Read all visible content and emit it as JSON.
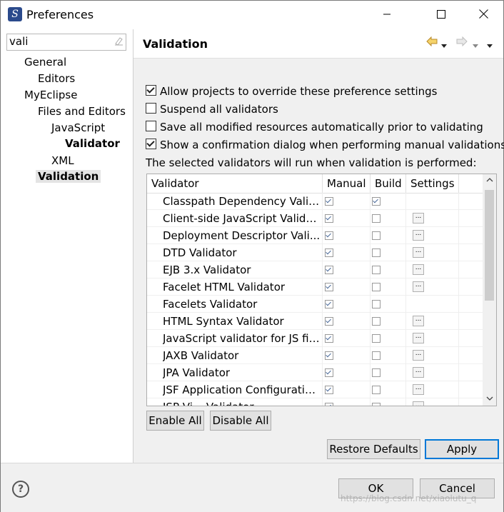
{
  "window": {
    "title": "Preferences",
    "minimize_icon": "minimize-icon",
    "maximize_icon": "maximize-icon",
    "close_icon": "close-icon"
  },
  "filter": {
    "value": "vali"
  },
  "tree": [
    {
      "label": "General"
    },
    {
      "label": "Editors"
    },
    {
      "label": "MyEclipse"
    },
    {
      "label": "Files and Editors"
    },
    {
      "label": "JavaScript"
    },
    {
      "label": "Validator"
    },
    {
      "label": "XML"
    },
    {
      "label": "Validation"
    }
  ],
  "page": {
    "title": "Validation"
  },
  "options": [
    {
      "label": "Allow projects to override these preference settings",
      "checked": true
    },
    {
      "label": "Suspend all validators",
      "checked": false
    },
    {
      "label": "Save all modified resources automatically prior to validating",
      "checked": false
    },
    {
      "label": "Show a confirmation dialog when performing manual validations",
      "checked": true
    }
  ],
  "info_text": "The selected validators will run when validation is performed:",
  "table": {
    "headers": [
      "Validator",
      "Manual",
      "Build",
      "Settings"
    ],
    "rows": [
      {
        "name": "Classpath Dependency Valid...",
        "manual": true,
        "build": true,
        "settings": false
      },
      {
        "name": "Client-side JavaScript Valida...",
        "manual": true,
        "build": false,
        "settings": true
      },
      {
        "name": "Deployment Descriptor Vali...",
        "manual": true,
        "build": false,
        "settings": true
      },
      {
        "name": "DTD Validator",
        "manual": true,
        "build": false,
        "settings": true
      },
      {
        "name": "EJB 3.x Validator",
        "manual": true,
        "build": false,
        "settings": true
      },
      {
        "name": "Facelet HTML Validator",
        "manual": true,
        "build": false,
        "settings": true
      },
      {
        "name": "Facelets Validator",
        "manual": true,
        "build": false,
        "settings": false
      },
      {
        "name": "HTML Syntax Validator",
        "manual": true,
        "build": false,
        "settings": true
      },
      {
        "name": "JavaScript validator for JS files",
        "manual": true,
        "build": false,
        "settings": true
      },
      {
        "name": "JAXB Validator",
        "manual": true,
        "build": false,
        "settings": true
      },
      {
        "name": "JPA Validator",
        "manual": true,
        "build": false,
        "settings": true
      },
      {
        "name": "JSF Application Configuratio...",
        "manual": true,
        "build": false,
        "settings": true
      },
      {
        "name": "JSP Vi... Validator",
        "manual": true,
        "build": false,
        "settings": true
      }
    ]
  },
  "buttons": {
    "enable_all": "Enable All",
    "disable_all": "Disable All",
    "restore_defaults": "Restore Defaults",
    "apply": "Apply",
    "ok": "OK",
    "cancel": "Cancel"
  },
  "watermark": "https://blog.csdn.net/xiaolutu_q"
}
